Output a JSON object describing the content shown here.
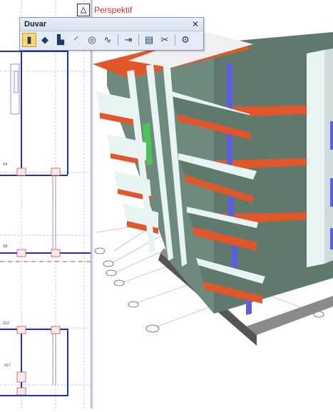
{
  "view": {
    "title": "Perspektif",
    "title_icon": "triangle-icon"
  },
  "toolbar": {
    "title": "Duvar",
    "close_glyph": "✕",
    "tools": [
      {
        "name": "wall-tool",
        "glyph": "▮",
        "active": true
      },
      {
        "name": "polygon-wall-tool",
        "glyph": "◆"
      },
      {
        "name": "column-tool",
        "glyph": "▙"
      },
      {
        "name": "arc-wall-tool",
        "glyph": "◜"
      },
      {
        "name": "circle-wall-tool",
        "glyph": "◎"
      },
      {
        "name": "curve-wall-tool",
        "glyph": "∿"
      },
      {
        "name": "offset-tool",
        "glyph": "⇥"
      },
      {
        "name": "properties-tool",
        "glyph": "▤"
      },
      {
        "name": "trim-tool",
        "glyph": "✂"
      },
      {
        "name": "settings-tool",
        "glyph": "⚙"
      }
    ]
  },
  "plan_labels": [
    "S4",
    "S8",
    "S12",
    "S17"
  ],
  "colors": {
    "facade": "#5f7a6d",
    "slab": "#e2572a",
    "slab_top": "#f5f5f5",
    "window": "#5b5ee3",
    "plan_line": "#1f2fbf",
    "accent": "#c0392b"
  }
}
